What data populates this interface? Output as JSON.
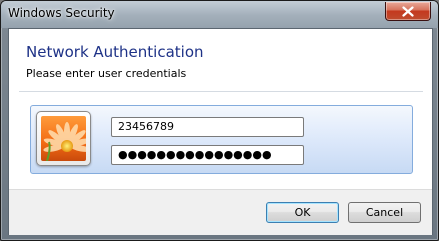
{
  "window": {
    "title": "Windows Security",
    "close_icon": "close-icon"
  },
  "dialog": {
    "heading": "Network Authentication",
    "subheading": "Please enter user credentials"
  },
  "credentials": {
    "avatar_icon": "user-flower-avatar",
    "username_value": "23456789",
    "password_masked": "●●●●●●●●●●●●●●●●"
  },
  "buttons": {
    "ok_label": "OK",
    "cancel_label": "Cancel"
  },
  "colors": {
    "heading": "#1e3287",
    "tile_border": "#84acdd",
    "close_red": "#c4391e"
  }
}
